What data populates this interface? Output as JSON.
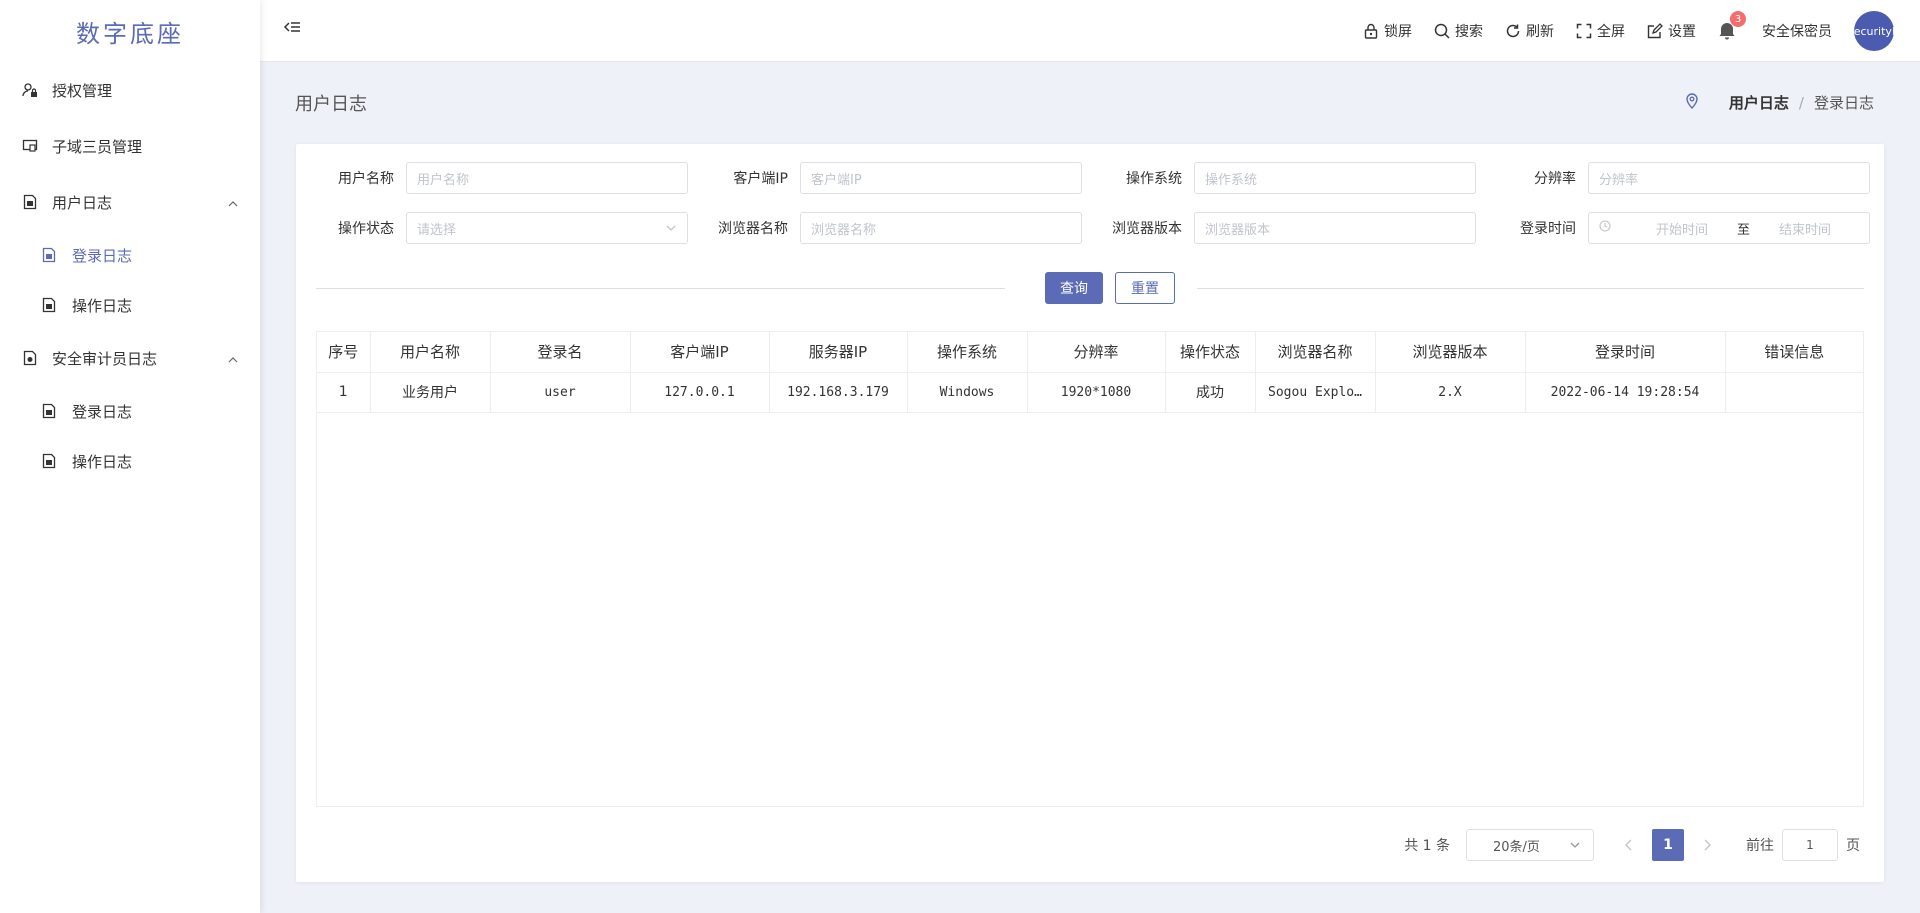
{
  "app": {
    "title": "数字底座"
  },
  "sidebar": {
    "items": [
      {
        "label": "授权管理",
        "icon": "user-lock-icon"
      },
      {
        "label": "子域三员管理",
        "icon": "monitor-icon"
      },
      {
        "label": "用户日志",
        "icon": "document-icon",
        "expanded": true,
        "children": [
          {
            "label": "登录日志",
            "active": true
          },
          {
            "label": "操作日志"
          }
        ]
      },
      {
        "label": "安全审计员日志",
        "icon": "document-icon",
        "expanded": true,
        "children": [
          {
            "label": "登录日志"
          },
          {
            "label": "操作日志"
          }
        ]
      }
    ]
  },
  "header": {
    "lock": "锁屏",
    "search": "搜索",
    "refresh": "刷新",
    "fullscreen": "全屏",
    "settings": "设置",
    "notification_count": "3",
    "user_name": "安全保密员",
    "avatar_text": "securityManager"
  },
  "page": {
    "title": "用户日志",
    "breadcrumb": {
      "current": "用户日志",
      "separator": "/",
      "last": "登录日志"
    }
  },
  "filters": {
    "username_label": "用户名称",
    "username_placeholder": "用户名称",
    "client_ip_label": "客户端IP",
    "client_ip_placeholder": "客户端IP",
    "os_label": "操作系统",
    "os_placeholder": "操作系统",
    "resolution_label": "分辨率",
    "resolution_placeholder": "分辨率",
    "status_label": "操作状态",
    "status_placeholder": "请选择",
    "browser_label": "浏览器名称",
    "browser_placeholder": "浏览器名称",
    "browser_version_label": "浏览器版本",
    "browser_version_placeholder": "浏览器版本",
    "login_time_label": "登录时间",
    "start_placeholder": "开始时间",
    "range_sep": "至",
    "end_placeholder": "结束时间"
  },
  "actions": {
    "query": "查询",
    "reset": "重置"
  },
  "table": {
    "headers": [
      "序号",
      "用户名称",
      "登录名",
      "客户端IP",
      "服务器IP",
      "操作系统",
      "分辨率",
      "操作状态",
      "浏览器名称",
      "浏览器版本",
      "登录时间",
      "错误信息"
    ],
    "rows": [
      [
        "1",
        "业务用户",
        "user",
        "127.0.0.1",
        "192.168.3.179",
        "Windows",
        "1920*1080",
        "成功",
        "Sogou Explo…",
        "2.X",
        "2022-06-14 19:28:54",
        ""
      ]
    ]
  },
  "pagination": {
    "total": "共 1 条",
    "page_size": "20条/页",
    "current_page": "1",
    "goto_label": "前往",
    "goto_value": "1",
    "page_suffix": "页"
  },
  "colors": {
    "accent": "#5b6bb5",
    "badge": "#f56c6c"
  }
}
